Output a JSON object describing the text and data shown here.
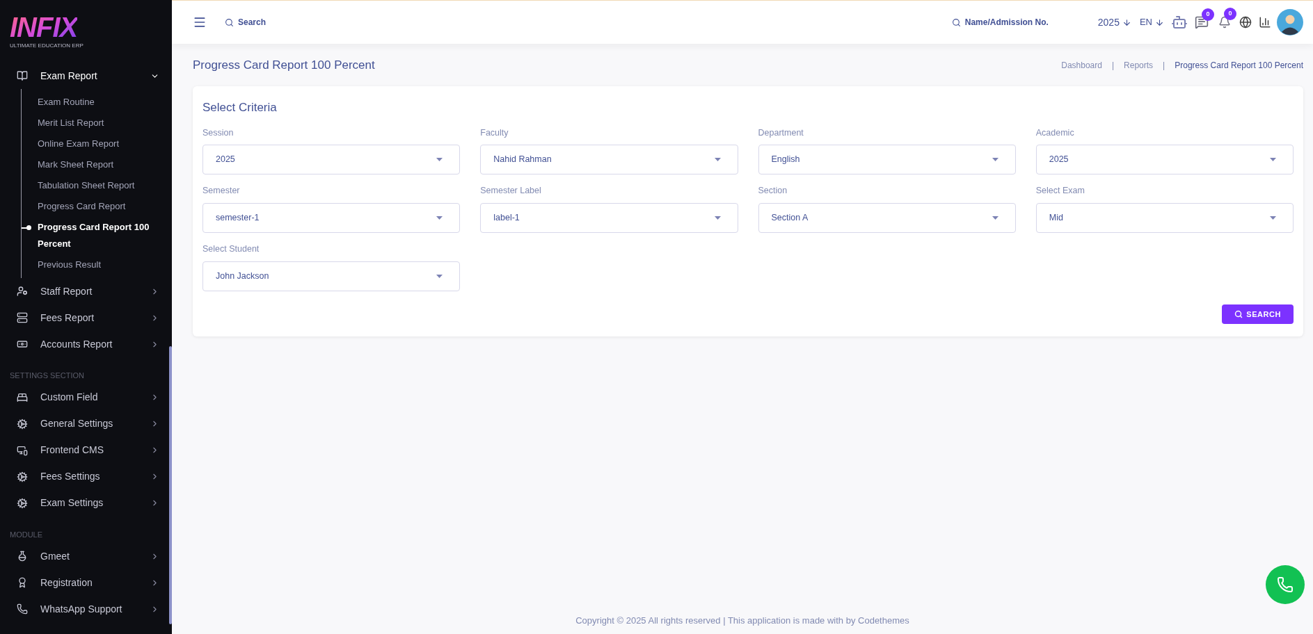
{
  "sidebar": {
    "logo": {
      "name": "INFIX",
      "tagline": "ULTIMATE EDUCATION ERP"
    },
    "sections": [
      {
        "items": [
          {
            "label": "Exam Report",
            "expanded": true,
            "children": [
              {
                "label": "Exam Routine",
                "selected": false
              },
              {
                "label": "Merit List Report",
                "selected": false
              },
              {
                "label": "Online Exam Report",
                "selected": false
              },
              {
                "label": "Mark Sheet Report",
                "selected": false
              },
              {
                "label": "Tabulation Sheet Report",
                "selected": false
              },
              {
                "label": "Progress Card Report",
                "selected": false
              },
              {
                "label": "Progress Card Report 100 Percent",
                "selected": true
              },
              {
                "label": "Previous Result",
                "selected": false
              }
            ]
          },
          {
            "label": "Staff Report",
            "expanded": false
          },
          {
            "label": "Fees Report",
            "expanded": false
          },
          {
            "label": "Accounts Report",
            "expanded": false
          }
        ]
      },
      {
        "heading": "SETTINGS SECTION",
        "items": [
          {
            "label": "Custom Field",
            "expanded": false
          },
          {
            "label": "General Settings",
            "expanded": false
          },
          {
            "label": "Frontend CMS",
            "expanded": false
          },
          {
            "label": "Fees Settings",
            "expanded": false
          },
          {
            "label": "Exam Settings",
            "expanded": false
          }
        ]
      },
      {
        "heading": "MODULE",
        "items": [
          {
            "label": "Gmeet",
            "expanded": false
          },
          {
            "label": "Registration",
            "expanded": false
          },
          {
            "label": "WhatsApp Support",
            "expanded": false
          }
        ]
      }
    ]
  },
  "header": {
    "search": {
      "placeholder": "Search"
    },
    "student_search": {
      "placeholder": "Name/Admission No."
    },
    "year": "2025",
    "language": "EN",
    "messages_count": "0",
    "notifications_count": "0"
  },
  "page": {
    "title": "Progress Card Report 100 Percent",
    "breadcrumbs": [
      "Dashboard",
      "Reports",
      "Progress Card Report 100 Percent"
    ],
    "breadcrumb_separator": "|"
  },
  "criteria": {
    "title": "Select Criteria",
    "fields": [
      {
        "label": "Session",
        "value": "2025"
      },
      {
        "label": "Faculty",
        "value": "Nahid Rahman"
      },
      {
        "label": "Department",
        "value": "English"
      },
      {
        "label": "Academic",
        "value": "2025"
      },
      {
        "label": "Semester",
        "value": "semester-1"
      },
      {
        "label": "Semester Label",
        "value": "label-1"
      },
      {
        "label": "Section",
        "value": "Section A"
      },
      {
        "label": "Select Exam",
        "value": "Mid"
      },
      {
        "label": "Select Student",
        "value": "John Jackson"
      }
    ],
    "button": "SEARCH"
  },
  "footer": "Copyright © 2025 All rights reserved | This application is made with by Codethemes"
}
